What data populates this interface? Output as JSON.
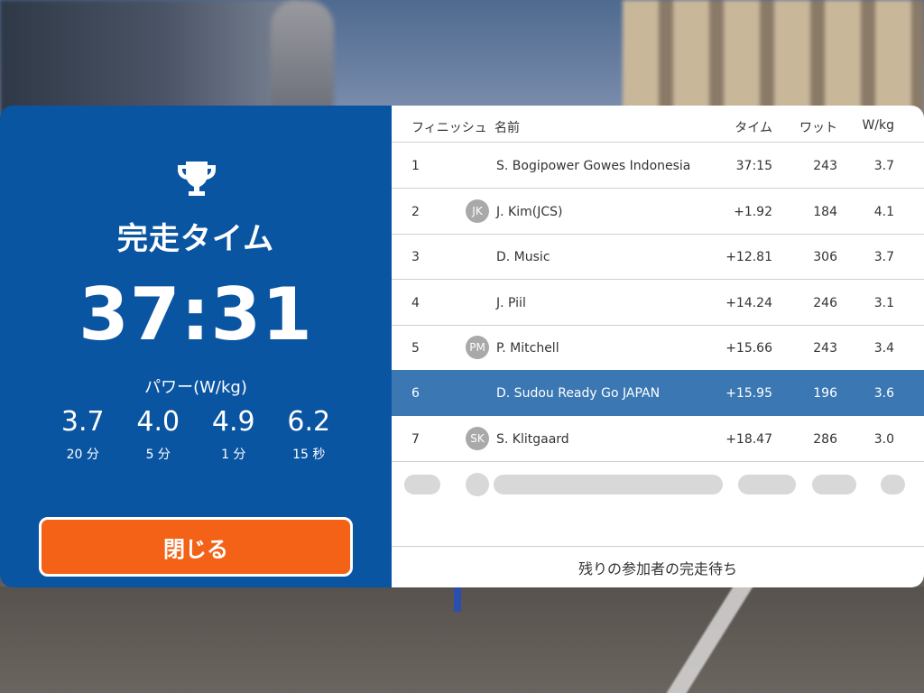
{
  "left": {
    "finish_label": "完走タイム",
    "finish_time": "37:31",
    "power_label": "パワー(W/kg)",
    "stats": [
      {
        "value": "3.7",
        "label": "20 分"
      },
      {
        "value": "4.0",
        "label": "5 分"
      },
      {
        "value": "4.9",
        "label": "1 分"
      },
      {
        "value": "6.2",
        "label": "15 秒"
      }
    ],
    "close_label": "閉じる",
    "trophy_icon": "trophy-icon"
  },
  "table": {
    "headers": {
      "finish": "フィニッシュ",
      "name": "名前",
      "time": "タイム",
      "watt": "ワット",
      "wkg": "W/kg"
    },
    "rows": [
      {
        "pos": "1",
        "avatar": "",
        "name": "S. Bogipower Gowes Indonesia",
        "time": "37:15",
        "watt": "243",
        "wkg": "3.7"
      },
      {
        "pos": "2",
        "avatar": "JK",
        "name": "J. Kim(JCS)",
        "time": "+1.92",
        "watt": "184",
        "wkg": "4.1"
      },
      {
        "pos": "3",
        "avatar": "",
        "name": "D. Music",
        "time": "+12.81",
        "watt": "306",
        "wkg": "3.7"
      },
      {
        "pos": "4",
        "avatar": "",
        "name": "J. Piil",
        "time": "+14.24",
        "watt": "246",
        "wkg": "3.1"
      },
      {
        "pos": "5",
        "avatar": "PM",
        "name": "P. Mitchell",
        "time": "+15.66",
        "watt": "243",
        "wkg": "3.4"
      },
      {
        "pos": "6",
        "avatar": "",
        "name": "D. Sudou  Ready Go JAPAN",
        "time": "+15.95",
        "watt": "196",
        "wkg": "3.6"
      },
      {
        "pos": "7",
        "avatar": "SK",
        "name": "S. Klitgaard",
        "time": "+18.47",
        "watt": "286",
        "wkg": "3.0"
      }
    ],
    "footer": "残りの参加者の完走待ち"
  },
  "colors": {
    "left_panel": "#0a55a2",
    "highlight_row": "#3a77b3",
    "close_button": "#f36216"
  }
}
